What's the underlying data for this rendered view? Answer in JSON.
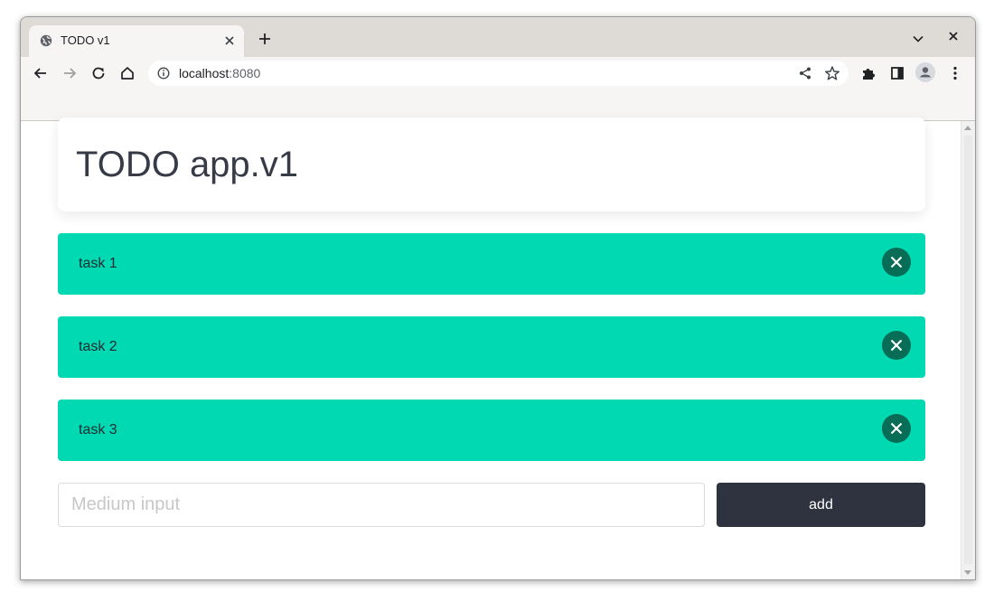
{
  "browser": {
    "tab_title": "TODO v1",
    "url_host": "localhost",
    "url_port": ":8080"
  },
  "page": {
    "title": "TODO app.v1",
    "tasks": [
      {
        "label": "task 1"
      },
      {
        "label": "task 2"
      },
      {
        "label": "task 3"
      }
    ],
    "input_placeholder": "Medium input",
    "input_value": "",
    "add_label": "add"
  },
  "colors": {
    "task_background": "#00d9b1",
    "delete_button": "#076d57",
    "add_button": "#2f323f",
    "title_text": "#363b46"
  },
  "icons": {
    "favicon": "globe-icon",
    "tab_close": "close-icon",
    "new_tab": "plus-icon",
    "back": "arrow-left-icon",
    "forward": "arrow-right-icon",
    "reload": "reload-icon",
    "home": "home-icon",
    "site_info": "info-icon",
    "share": "share-icon",
    "bookmark": "star-icon",
    "extensions": "puzzle-icon",
    "side_panel": "side-panel-icon",
    "profile": "avatar-icon",
    "menu": "kebab-menu-icon",
    "delete_task": "close-circle-icon"
  }
}
